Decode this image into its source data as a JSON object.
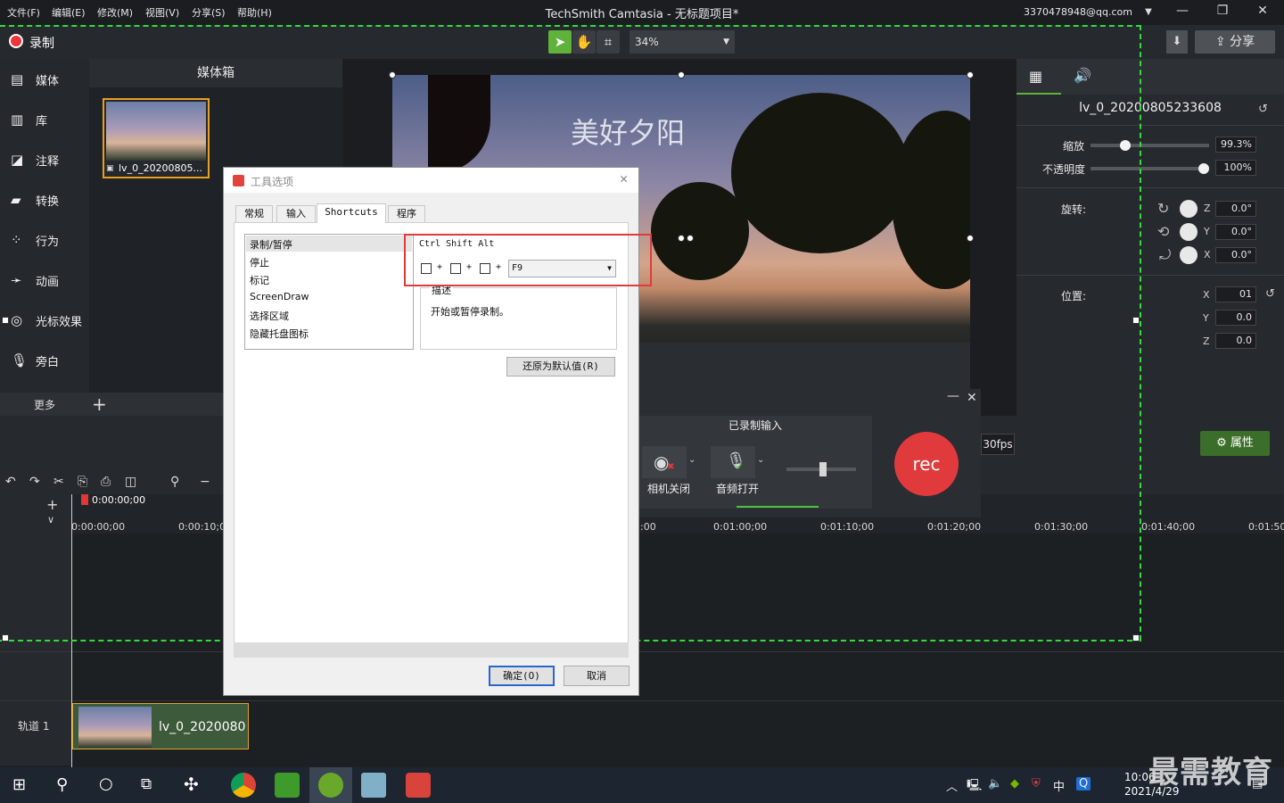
{
  "menu": {
    "file": "文件(F)",
    "edit": "编辑(E)",
    "modify": "修改(M)",
    "view": "视图(V)",
    "share": "分享(S)",
    "help": "帮助(H)"
  },
  "app_title": "TechSmith Camtasia - 无标题项目*",
  "user_email": "3370478948@qq.com",
  "toolbar": {
    "record_label": "录制",
    "zoom": "34%",
    "share_label": "分享"
  },
  "sidebar": {
    "items": [
      {
        "label": "媒体",
        "icon": "film-icon"
      },
      {
        "label": "库",
        "icon": "library-icon"
      },
      {
        "label": "注释",
        "icon": "annotation-icon"
      },
      {
        "label": "转换",
        "icon": "transition-icon"
      },
      {
        "label": "行为",
        "icon": "behavior-icon"
      },
      {
        "label": "动画",
        "icon": "animation-icon"
      },
      {
        "label": "光标效果",
        "icon": "cursor-effect-icon"
      },
      {
        "label": "旁白",
        "icon": "microphone-icon"
      }
    ],
    "more": "更多"
  },
  "media_bin": {
    "title": "媒体箱",
    "thumb_label": "lv_0_20200805..."
  },
  "video_caption": "美好夕阳",
  "properties": {
    "clip_name": "lv_0_20200805233608",
    "scale_label": "缩放",
    "scale_value": "99.3%",
    "scale_level": 0.27,
    "opacity_label": "不透明度",
    "opacity_value": "100%",
    "opacity_level": 1.0,
    "rotation_label": "旋转:",
    "rot_z": "0.0°",
    "rot_y": "0.0°",
    "rot_x": "0.0°",
    "position_label": "位置:",
    "pos_x": "01",
    "pos_y": "0.0",
    "pos_z": "0.0",
    "axis_z": "Z",
    "axis_y": "Y",
    "axis_x": "X"
  },
  "strip": {
    "fps": "30fps",
    "attr_label": "属性"
  },
  "timeline": {
    "playhead": "0:00:00;00",
    "ticks": [
      "0:00:00;00",
      "0:00:10;00",
      ":00",
      "0:01:00;00",
      "0:01:10;00",
      "0:01:20;00",
      "0:01:30;00",
      "0:01:40;00",
      "0:01:50;"
    ],
    "track_label": "轨道 1",
    "clip_label": "lv_0_2020080"
  },
  "recorder": {
    "title": "已录制输入",
    "camera_label": "相机关闭",
    "mic_label": "音频打开",
    "rec_label": "rec"
  },
  "dialog": {
    "title": "工具选项",
    "tabs": [
      "常规",
      "输入",
      "Shortcuts",
      "程序"
    ],
    "actions": [
      "录制/暂停",
      "停止",
      "标记",
      "ScreenDraw",
      "选择区域",
      "隐藏托盘图标"
    ],
    "keys_label": "Ctrl Shift Alt",
    "plus": "+",
    "key_value": "F9",
    "desc_title": "描述",
    "desc_text": "开始或暂停录制。",
    "reset_label": "还原为默认值(R)",
    "ok_label": "确定(O)",
    "cancel_label": "取消"
  },
  "taskbar": {
    "time": "10:06",
    "date": "2021/4/29",
    "ime": "中"
  },
  "watermark": "最需教育",
  "colors": {
    "accent_green": "#2fdc3a",
    "record_red": "#e03a3c",
    "highlight_box": "#e23a3c",
    "clip_border": "#e3a22a"
  }
}
